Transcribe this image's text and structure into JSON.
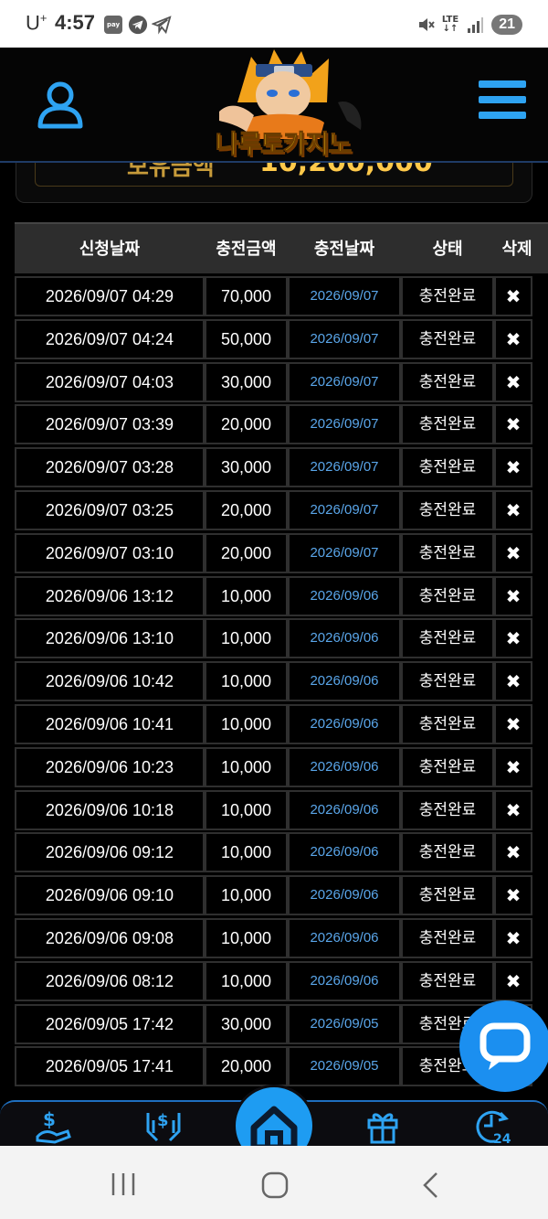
{
  "status_bar": {
    "carrier": "U",
    "carrier_plus": "+",
    "time": "4:57",
    "pay_label": "pay",
    "lte_label": "LTE",
    "battery": "21"
  },
  "header": {
    "logo_text": "나루토카지노"
  },
  "balance": {
    "label": "보유금액",
    "value": "10,200,000"
  },
  "table": {
    "headers": {
      "request_date": "신청날짜",
      "amount": "충전금액",
      "charge_date": "충전날짜",
      "status": "상태",
      "delete": "삭제"
    },
    "delete_symbol": "✖",
    "rows": [
      {
        "request_date": "2026/09/07 04:29",
        "amount": "70,000",
        "charge_date": "2026/09/07",
        "status": "충전완료"
      },
      {
        "request_date": "2026/09/07 04:24",
        "amount": "50,000",
        "charge_date": "2026/09/07",
        "status": "충전완료"
      },
      {
        "request_date": "2026/09/07 04:03",
        "amount": "30,000",
        "charge_date": "2026/09/07",
        "status": "충전완료"
      },
      {
        "request_date": "2026/09/07 03:39",
        "amount": "20,000",
        "charge_date": "2026/09/07",
        "status": "충전완료"
      },
      {
        "request_date": "2026/09/07 03:28",
        "amount": "30,000",
        "charge_date": "2026/09/07",
        "status": "충전완료"
      },
      {
        "request_date": "2026/09/07 03:25",
        "amount": "20,000",
        "charge_date": "2026/09/07",
        "status": "충전완료"
      },
      {
        "request_date": "2026/09/07 03:10",
        "amount": "20,000",
        "charge_date": "2026/09/07",
        "status": "충전완료"
      },
      {
        "request_date": "2026/09/06 13:12",
        "amount": "10,000",
        "charge_date": "2026/09/06",
        "status": "충전완료"
      },
      {
        "request_date": "2026/09/06 13:10",
        "amount": "10,000",
        "charge_date": "2026/09/06",
        "status": "충전완료"
      },
      {
        "request_date": "2026/09/06 10:42",
        "amount": "10,000",
        "charge_date": "2026/09/06",
        "status": "충전완료"
      },
      {
        "request_date": "2026/09/06 10:41",
        "amount": "10,000",
        "charge_date": "2026/09/06",
        "status": "충전완료"
      },
      {
        "request_date": "2026/09/06 10:23",
        "amount": "10,000",
        "charge_date": "2026/09/06",
        "status": "충전완료"
      },
      {
        "request_date": "2026/09/06 10:18",
        "amount": "10,000",
        "charge_date": "2026/09/06",
        "status": "충전완료"
      },
      {
        "request_date": "2026/09/06 09:12",
        "amount": "10,000",
        "charge_date": "2026/09/06",
        "status": "충전완료"
      },
      {
        "request_date": "2026/09/06 09:10",
        "amount": "10,000",
        "charge_date": "2026/09/06",
        "status": "충전완료"
      },
      {
        "request_date": "2026/09/06 09:08",
        "amount": "10,000",
        "charge_date": "2026/09/06",
        "status": "충전완료"
      },
      {
        "request_date": "2026/09/06 08:12",
        "amount": "10,000",
        "charge_date": "2026/09/06",
        "status": "충전완료"
      },
      {
        "request_date": "2026/09/05 17:42",
        "amount": "30,000",
        "charge_date": "2026/09/05",
        "status": "충전완료"
      },
      {
        "request_date": "2026/09/05 17:41",
        "amount": "20,000",
        "charge_date": "2026/09/05",
        "status": "충전완료"
      }
    ]
  },
  "bottom_nav": {
    "items": [
      "deposit-icon",
      "withdraw-icon",
      "home-icon",
      "gift-icon",
      "support-24-icon"
    ],
    "support_label": "24"
  },
  "colors": {
    "accent": "#1e9cf2",
    "date_blue": "#5aa6ea",
    "logo_yellow": "#ffd21a"
  }
}
